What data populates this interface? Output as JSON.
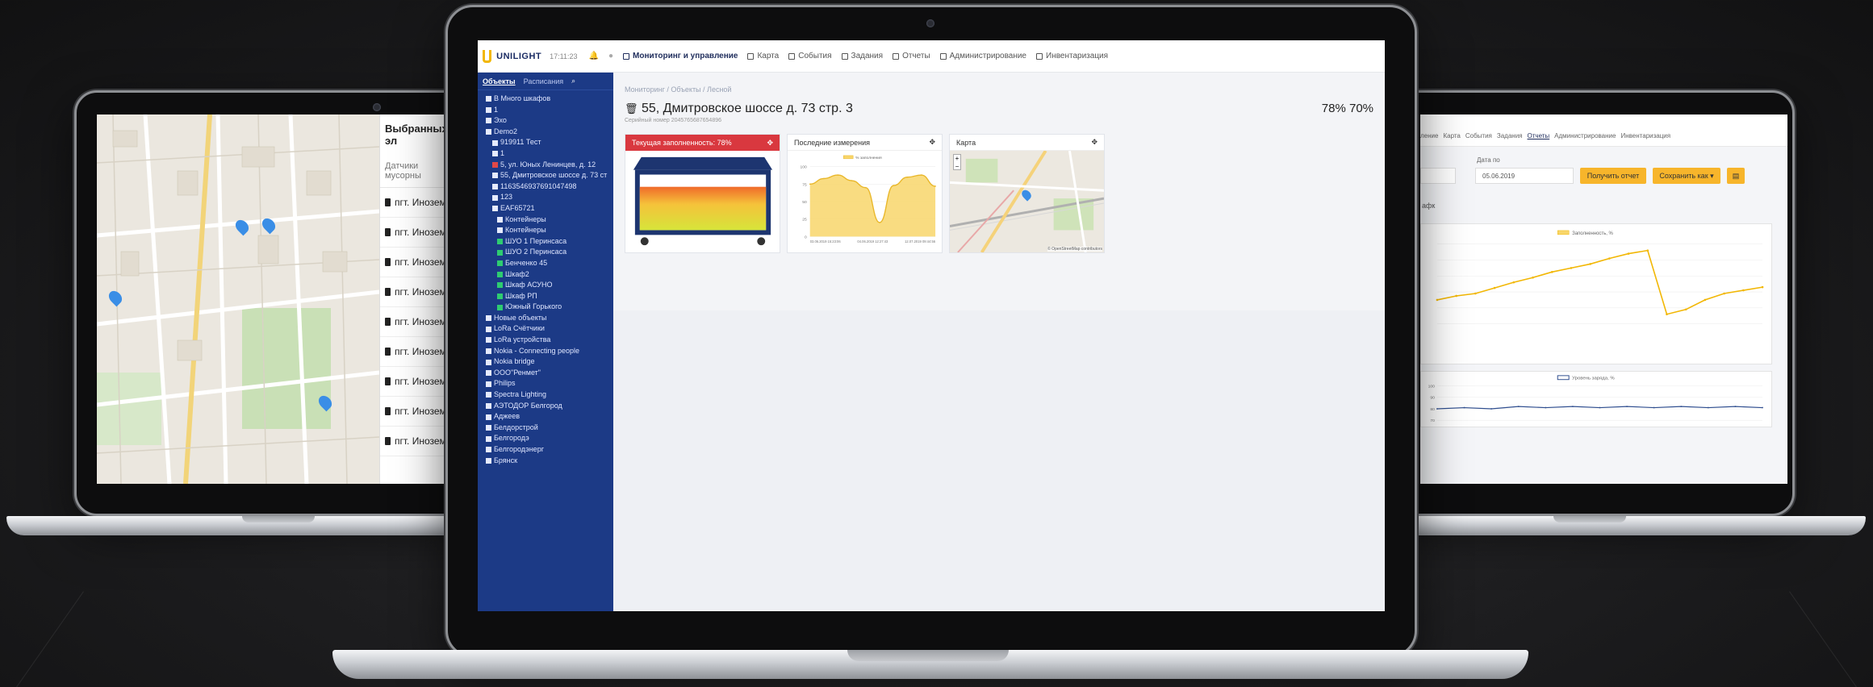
{
  "left_panel": {
    "title": "Выбранных эл",
    "subtitle": "Датчики мусорны",
    "items": [
      "пгт. Иноземце",
      "пгт. Иноземце",
      "пгт. Иноземце",
      "пгт. Иноземце",
      "пгт. Иноземце",
      "пгт. Иноземце",
      "пгт. Иноземце",
      "пгт. Иноземце",
      "пгт. Иноземце"
    ]
  },
  "main": {
    "logo": "UNILIGHT",
    "time": "17:11:23",
    "nav": [
      {
        "label": "Мониторинг и управление",
        "icon": "monitor-icon",
        "active": true
      },
      {
        "label": "Карта",
        "icon": "map-pin-icon"
      },
      {
        "label": "События",
        "icon": "calendar-icon"
      },
      {
        "label": "Задания",
        "icon": "list-icon"
      },
      {
        "label": "Отчеты",
        "icon": "chart-icon"
      },
      {
        "label": "Администрирование",
        "icon": "gear-icon"
      },
      {
        "label": "Инвентаризация",
        "icon": "pencil-icon"
      }
    ],
    "sidebar_tabs": [
      "Объекты",
      "Расписания"
    ],
    "tree": [
      "В Много шкафов",
      "1",
      "Эхо",
      "Demo2",
      "919911 Тест",
      "1",
      "5, ул. Юных Ленинцев, д. 12",
      "55, Дмитровское шоссе д. 73 ст",
      "1163546937691047498",
      "123",
      "EAF65721",
      "Контейнеры",
      "Контейнеры",
      "ШУО 1 Перинсаса",
      "ШУО 2 Перинсаса",
      "Бенченко 45",
      "Шкаф2",
      "Шкаф АСУНО",
      "Шкаф РП",
      "Южный Горького",
      "Новые объекты",
      "LoRa Счётчики",
      "LoRa устройства",
      "Nokia - Connecting people",
      "Nokia bridge",
      "ООО\"Ренмет\"",
      "Philips",
      "Spectra Lighting",
      "АЭТОДОР Белгород",
      "Аджеев",
      "Белдорстрой",
      "Белгородэ",
      "Белгородэнерг",
      "Брянск"
    ],
    "breadcrumb": "Мониторинг / Объекты / Лесной",
    "object_title": "55, Дмитровское шоссе д. 73 стр. 3",
    "object_subtitle": "Серийный номер 2045765687654896",
    "stats": "78%  70%",
    "cards": [
      {
        "title": "Текущая заполненность: 78%",
        "fill_percent": 78
      },
      {
        "title": "Последние измерения",
        "legend": "% заполнения"
      },
      {
        "title": "Карта",
        "attribution": "© OpenStreetMap contributors"
      }
    ]
  },
  "line_chart": {
    "legend": "% заполнения",
    "yticks": [
      "100",
      "75",
      "50",
      "25",
      "0"
    ],
    "xticks": [
      "03.06.2019 15:23:06",
      "04.06.2019 12:27:43",
      "12.07.2019 09:44:56"
    ]
  },
  "right_panel": {
    "tabs": [
      "ление",
      "Карта",
      "События",
      "Задания",
      "Отчеты",
      "Администрирование",
      "Инвентаризация"
    ],
    "date_label": "Дата по",
    "date_value": "05.06.2019",
    "btn_report": "Получить отчет",
    "btn_save": "Сохранить как ▾",
    "caption": "афк",
    "chart1_legend": "Заполненность, %",
    "chart2_legend": "Уровень заряда, %",
    "chart2_yticks": [
      "100",
      "90",
      "80",
      "70"
    ]
  },
  "chart_data": [
    {
      "type": "line",
      "title": "Последние измерения",
      "series": [
        {
          "name": "% заполнения",
          "values": [
            75,
            83,
            88,
            80,
            70,
            20,
            73,
            85,
            88,
            72
          ]
        }
      ],
      "ylim": [
        0,
        100
      ]
    },
    {
      "type": "line",
      "series": [
        {
          "name": "Заполненность, %",
          "values": [
            30,
            35,
            38,
            45,
            52,
            58,
            65,
            70,
            75,
            82,
            88,
            92,
            12,
            18,
            30,
            38,
            42,
            46
          ]
        }
      ]
    },
    {
      "type": "line",
      "series": [
        {
          "name": "Уровень заряда, %",
          "values": [
            80,
            81,
            80,
            82,
            81,
            82,
            81,
            82,
            81,
            82,
            81,
            82,
            81
          ]
        }
      ],
      "ylim": [
        70,
        100
      ]
    }
  ],
  "colors": {
    "accent_blue": "#1c3a86",
    "alert_red": "#d9383f",
    "yellow": "#f7b52b",
    "chart_fill": "#f8d66b"
  }
}
